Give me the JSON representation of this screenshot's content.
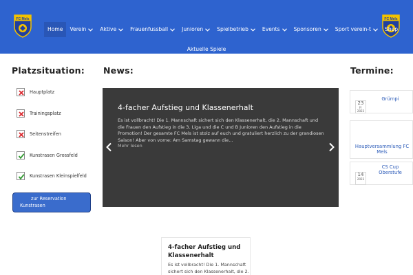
{
  "header": {
    "logo_text": "FC Mels",
    "nav": [
      {
        "label": "Home",
        "active": true,
        "dropdown": false
      },
      {
        "label": "Verein",
        "dropdown": true
      },
      {
        "label": "Aktive",
        "dropdown": true
      },
      {
        "label": "Frauenfussball",
        "dropdown": true
      },
      {
        "label": "Junioren",
        "dropdown": true
      },
      {
        "label": "Spielbetrieb",
        "dropdown": true
      },
      {
        "label": "Events",
        "dropdown": true
      },
      {
        "label": "Sponsoren",
        "dropdown": true
      },
      {
        "label": "Sport verein-t",
        "dropdown": true
      },
      {
        "label": "Shop",
        "dropdown": false
      }
    ],
    "nav_row2": "Aktuelle Spiele"
  },
  "platz": {
    "heading": "Platzsituation:",
    "items": [
      {
        "label": "Hauptplatz",
        "status": "closed"
      },
      {
        "label": "Trainingsplatz",
        "status": "closed"
      },
      {
        "label": "Seitenstreifen",
        "status": "closed"
      },
      {
        "label": "Kunstrasen Grossfeld",
        "status": "open"
      },
      {
        "label": "Kunstrasen Kleinspielfeld",
        "status": "open"
      }
    ],
    "reserve_line1": "zur Reservation",
    "reserve_line2": "Kunstrasen"
  },
  "news": {
    "heading": "News:",
    "slide_title": "4-facher Aufstieg und Klassenerhalt",
    "slide_text": "Es ist vollbracht! Die 1. Mannschaft sichert sich den Klassenerhalt, die 2. Mannschaft und die Frauen den Aufstieg in die 3. Liga und die C und B Junioren den Aufstieg in die Promotion! Der gesamte FC Mels ist stolz auf euch und gratuliert herzlich zu der grandiosen Saison! Aber von vorne: Am Samstag gewann die…",
    "slide_more": "Mehr lesen",
    "card_title": "4-facher Aufstieg und Klassenerhalt",
    "card_text": "Es ist vollbracht! Die 1. Mannschaft sichert sich den Klassenerhalt, die 2."
  },
  "termine": {
    "heading": "Termine:",
    "items": [
      {
        "title": "Grümpi",
        "day": "23",
        "weekday": "Fr",
        "year": "2023"
      },
      {
        "title": "Hauptversammlung FC Mels",
        "day": "",
        "weekday": "",
        "year": ""
      },
      {
        "title": "CS Cup Oberstufe",
        "day": "14",
        "weekday": "",
        "year": "2023"
      }
    ]
  },
  "colors": {
    "header_bg": "#2e63cf",
    "accent": "#3a6ccc",
    "closed": "#d9262c",
    "open": "#2e9a2e"
  }
}
